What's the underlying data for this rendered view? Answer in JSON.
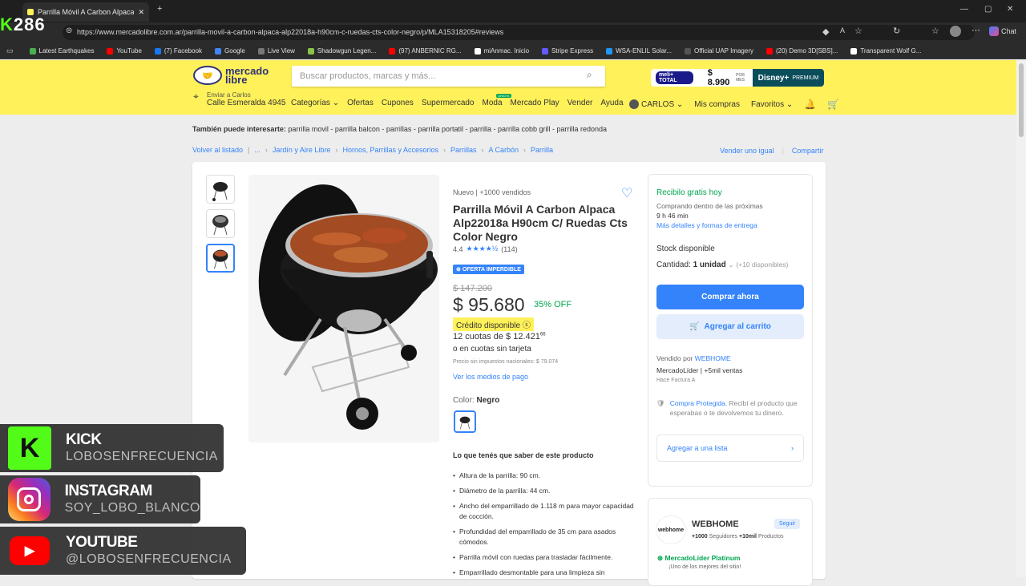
{
  "browser": {
    "tab_title": "Parrilla Móvil A Carbon Alpaca Alp",
    "url": "https://www.mercadolibre.com.ar/parrilla-movil-a-carbon-alpaca-alp22018a-h90cm-c-ruedas-cts-color-negro/p/MLA15318205#reviews",
    "chat_label": "Chat",
    "bookmarks": [
      {
        "label": "Latest Earthquakes",
        "color": "#4caf50"
      },
      {
        "label": "YouTube",
        "color": "#ff0000"
      },
      {
        "label": "(7) Facebook",
        "color": "#1877f2"
      },
      {
        "label": "Google",
        "color": "#4285f4"
      },
      {
        "label": "Live View",
        "color": "#777777"
      },
      {
        "label": "Shadowgun Legen...",
        "color": "#8bc34a"
      },
      {
        "label": "(97) ANBERNIC RG...",
        "color": "#ff0000"
      },
      {
        "label": "miAnmac. Inicio",
        "color": "#ffffff"
      },
      {
        "label": "Stripe Express",
        "color": "#635bff"
      },
      {
        "label": "WSA-ENLIL Solar...",
        "color": "#2196f3"
      },
      {
        "label": "Official UAP Imagery",
        "color": "#555555"
      },
      {
        "label": "(20) Demo 3D[SBS]...",
        "color": "#ff0000"
      },
      {
        "label": "Transparent Wolf G...",
        "color": "#ffffff"
      }
    ]
  },
  "header": {
    "logo_line1": "mercado",
    "logo_line2": "libre",
    "search_placeholder": "Buscar productos, marcas y más...",
    "promo_meli": "meli+ TOTAL",
    "promo_price": "$ 8.990",
    "promo_per": "POR MES",
    "promo_disney": "Disney+",
    "promo_premium": "PREMIUM",
    "ship_to": "Enviar a Carlos",
    "address": "Calle Esmeralda 4945",
    "nav": [
      "Categorías ⌄",
      "Ofertas",
      "Cupones",
      "Supermercado",
      "Moda",
      "Mercado Play",
      "Vender",
      "Ayuda"
    ],
    "gratis_badge": "GRATIS",
    "user_name": "CARLOS ⌄",
    "mis_compras": "Mis compras",
    "favoritos": "Favoritos ⌄"
  },
  "page": {
    "suggest_label": "También puede interesarte:",
    "suggest_items": "parrilla movil - parrilla balcon - parrillas - parrilla portatil - parrilla - parrilla cobb grill - parrilla redonda",
    "back": "Volver al listado",
    "crumbs": [
      "...",
      "Jardín y Aire Libre",
      "Hornos, Parrillas y Accesorios",
      "Parrillas",
      "A Carbón",
      "Parrilla"
    ],
    "sell_same": "Vender uno igual",
    "share": "Compartir"
  },
  "product": {
    "condition": "Nuevo  |  +1000 vendidos",
    "title": "Parrilla Móvil A Carbon Alpaca Alp22018a H90cm C/ Ruedas Cts Color Negro",
    "rating": "4.4",
    "stars": "★★★★½",
    "reviews": "(114)",
    "offer_badge": "OFERTA IMPERDIBLE",
    "old_price": "$ 147.200",
    "price": "$ 95.680",
    "discount": "35% OFF",
    "credit": "Crédito disponible",
    "installments": "12 cuotas de $ 12.421",
    "installments_cents": "66",
    "installments_alt": "o en cuotas sin tarjeta",
    "no_tax": "Precio sin impuestos nacionales: $ 79.074",
    "payment_link": "Ver los medios de pago",
    "color_label": "Color:",
    "color_value": "Negro",
    "know_title": "Lo que tenés que saber de este producto",
    "bullets": [
      "Altura de la parrilla: 90 cm.",
      "Diámetro de la parrilla: 44 cm.",
      "Ancho del emparrillado de 1.118 m para mayor capacidad de cocción.",
      "Profundidad del emparrillado de 35 cm para asados cómodos.",
      "Parrilla móvil con ruedas para trasladar fácilmente.",
      "Emparrillado desmontable para una limpieza sin"
    ]
  },
  "buybox": {
    "free": "Recibilo gratis hoy",
    "buying_within": "Comprando dentro de las próximas",
    "time": "9 h 46 min",
    "details": "Más detalles y formas de entrega",
    "stock": "Stock disponible",
    "qty_label": "Cantidad:",
    "qty_value": "1 unidad",
    "qty_avail": "(+10 disponibles)",
    "buy_now": "Comprar ahora",
    "add_cart": "Agregar al carrito",
    "sold_by": "Vendido por",
    "seller_link": "WEBHOME",
    "leader": "MercadoLíder  |  +5mil ventas",
    "invoice": "Hace Factura A",
    "protected_link": "Compra Protegida.",
    "protected_text": "Recibí el producto que esperabas o te devolvemos tu dinero.",
    "add_list": "Agregar a una lista"
  },
  "seller": {
    "logo": "webhome",
    "name": "WEBHOME",
    "follow": "Seguir",
    "followers": "+1000",
    "followers_label": "Seguidores",
    "products": "+10mil",
    "products_label": "Productos",
    "platinum": "MercadoLíder Platinum",
    "best": "¡Uno de los mejores del sitio!"
  },
  "overlays": {
    "counter": "286",
    "kick_title": "KICK",
    "kick_handle": "LOBOSENFRECUENCIA",
    "ig_title": "INSTAGRAM",
    "ig_handle": "SOY_LOBO_BLANCO",
    "yt_title": "YOUTUBE",
    "yt_handle": "@LOBOSENFRECUENCIA"
  }
}
